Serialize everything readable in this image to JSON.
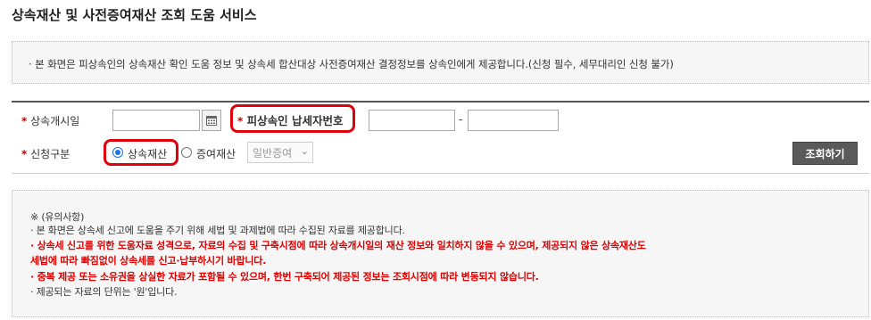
{
  "page": {
    "title": "상속재산 및 사전증여재산 조회 도움 서비스"
  },
  "info": {
    "text": "· 본 화면은 피상속인의 상속재산 확인 도움 정보 및 상속세 합산대상 사전증여재산 결정정보를 상속인에게 제공합니다.(신청 필수, 세무대리인 신청 불가)"
  },
  "form": {
    "required_mark": "*",
    "start_date_label": "상속개시일",
    "start_date_value": "",
    "decedent_tin_label": "피상속인 납세자번호",
    "tin_part1_value": "",
    "tin_separator": "-",
    "tin_part2_value": "",
    "request_type_label": "신청구분",
    "options": {
      "inheritance": "상속재산",
      "gift": "증여재산"
    },
    "selected_option": "inheritance",
    "gift_type_select": "일반증여",
    "query_button": "조회하기"
  },
  "notice": {
    "heading": "※ (유의사항)",
    "lines": [
      {
        "text": "· 본 화면은 상속세 신고에 도움을 주기 위해 세법 및 과제법에 따라 수집된 자료를 제공합니다.",
        "style": "black"
      },
      {
        "text": "· 상속세 신고를 위한 도움자료 성격으로, 자료의 수집 및 구축시점에 따라 상속개시일의 재산 정보와 일치하지 않을 수 있으며, 제공되지 않은 상속재산도",
        "style": "red"
      },
      {
        "text": "  세법에 따라 빠짐없이 상속세를 신고·납부하시기 바랍니다.",
        "style": "red"
      },
      {
        "text": "· 중복 제공 또는 소유권을 상실한 자료가 포함될 수 있으며, 한번 구축되어 제공된 정보는 조회시점에 따라 변동되지 않습니다.",
        "style": "red"
      },
      {
        "text": "· 제공되는 자료의 단위는 '원'입니다.",
        "style": "black"
      }
    ]
  },
  "colors": {
    "required": "#cc0000",
    "highlight_oval": "#e0000b",
    "notice_red": "#e00000",
    "button_bg": "#5a5a5a"
  }
}
